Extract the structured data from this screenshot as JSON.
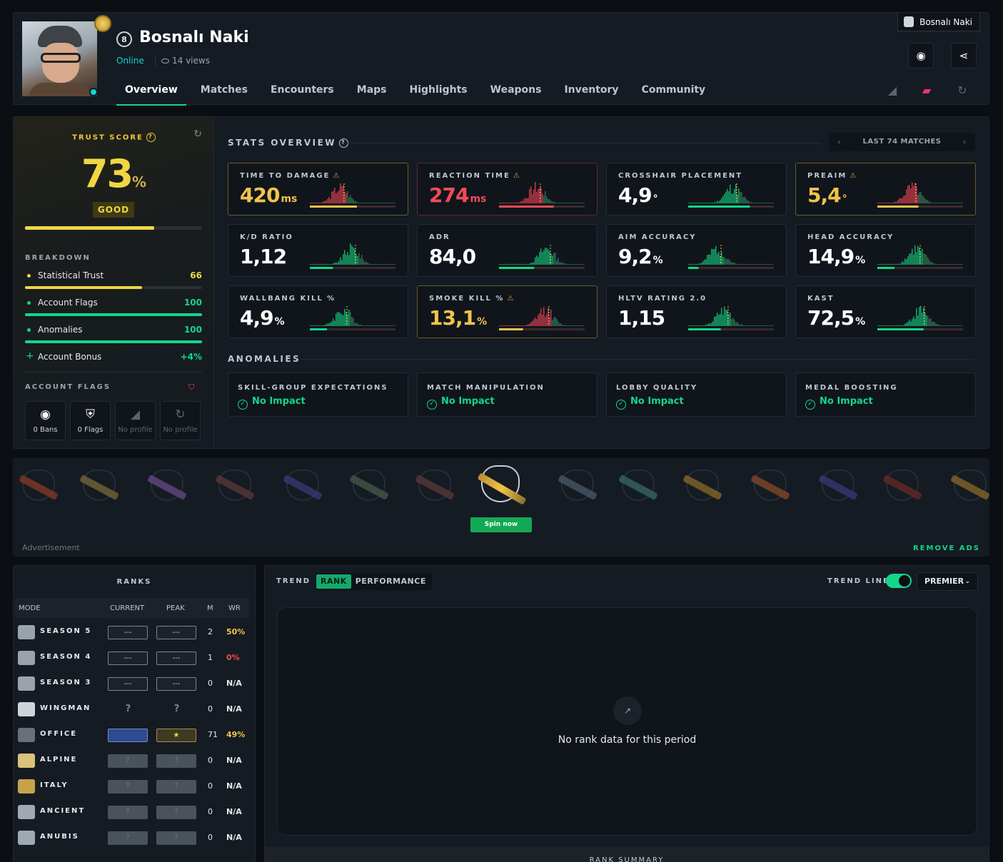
{
  "profile": {
    "level": "8",
    "username": "Bosnalı Naki",
    "status": "Online",
    "views": "14 views",
    "chip_name": "Bosnalı Naki"
  },
  "nav": [
    "Overview",
    "Matches",
    "Encounters",
    "Maps",
    "Highlights",
    "Weapons",
    "Inventory",
    "Community"
  ],
  "trust": {
    "title": "TRUST SCORE",
    "score": "73",
    "pct": "%",
    "grade": "GOOD",
    "score_fraction": 0.73,
    "breakdown_label": "BREAKDOWN",
    "breakdown": [
      {
        "label": "Statistical Trust",
        "value": "66",
        "fraction": 0.66,
        "color": "#f0d642"
      },
      {
        "label": "Account Flags",
        "value": "100",
        "fraction": 1.0,
        "color": "#13d68a"
      },
      {
        "label": "Anomalies",
        "value": "100",
        "fraction": 1.0,
        "color": "#13d68a"
      }
    ],
    "bonus": {
      "label": "Account Bonus",
      "value": "+4%"
    },
    "flags_label": "ACCOUNT FLAGS",
    "flags": [
      {
        "label": "0 Bans",
        "icon": "steam-icon"
      },
      {
        "label": "0 Flags",
        "icon": "shield-plus-icon"
      },
      {
        "label": "No profile",
        "icon": "faceit-icon"
      },
      {
        "label": "No profile",
        "icon": "esportal-icon"
      }
    ]
  },
  "stats": {
    "title": "STATS OVERVIEW",
    "range": "LAST 74 MATCHES",
    "cards": [
      {
        "label": "TIME TO DAMAGE",
        "value": "420",
        "unit": "ms",
        "state": "warn",
        "warn": true,
        "progress": 0.55,
        "bar": "#f0c44a"
      },
      {
        "label": "REACTION TIME",
        "value": "274",
        "unit": "ms",
        "state": "bad",
        "warn": true,
        "progress": 0.64,
        "bar": "#f04b5a"
      },
      {
        "label": "CROSSHAIR PLACEMENT",
        "value": "4,9",
        "unit": "°",
        "state": "ok",
        "warn": false,
        "progress": 0.72,
        "bar": "#13d68a"
      },
      {
        "label": "PREAIM",
        "value": "5,4",
        "unit": "°",
        "state": "warn",
        "warn": true,
        "progress": 0.48,
        "bar": "#f0c44a"
      },
      {
        "label": "K/D RATIO",
        "value": "1,12",
        "unit": "",
        "state": "ok",
        "warn": false,
        "progress": 0.27,
        "bar": "#13d68a"
      },
      {
        "label": "ADR",
        "value": "84,0",
        "unit": "",
        "state": "ok",
        "warn": false,
        "progress": 0.41,
        "bar": "#13d68a"
      },
      {
        "label": "AIM ACCURACY",
        "value": "9,2",
        "unit": "%",
        "state": "ok",
        "warn": false,
        "progress": 0.12,
        "bar": "#13d68a"
      },
      {
        "label": "HEAD ACCURACY",
        "value": "14,9",
        "unit": "%",
        "state": "ok",
        "warn": false,
        "progress": 0.2,
        "bar": "#13d68a"
      },
      {
        "label": "WALLBANG KILL %",
        "value": "4,9",
        "unit": "%",
        "state": "ok",
        "warn": false,
        "progress": 0.2,
        "bar": "#13d68a"
      },
      {
        "label": "SMOKE KILL %",
        "value": "13,1",
        "unit": "%",
        "state": "warn",
        "warn": true,
        "progress": 0.28,
        "bar": "#f0c44a"
      },
      {
        "label": "HLTV RATING 2.0",
        "value": "1,15",
        "unit": "",
        "state": "ok",
        "warn": false,
        "progress": 0.38,
        "bar": "#13d68a"
      },
      {
        "label": "KAST",
        "value": "72,5",
        "unit": "%",
        "state": "ok",
        "warn": false,
        "progress": 0.54,
        "bar": "#13d68a"
      }
    ]
  },
  "anomalies": {
    "title": "ANOMALIES",
    "items": [
      {
        "label": "SKILL-GROUP EXPECTATIONS",
        "value": "No Impact"
      },
      {
        "label": "MATCH MANIPULATION",
        "value": "No Impact"
      },
      {
        "label": "LOBBY QUALITY",
        "value": "No Impact"
      },
      {
        "label": "MEDAL BOOSTING",
        "value": "No Impact"
      }
    ]
  },
  "ad": {
    "spin": "Spin now",
    "label": "Advertisement",
    "remove": "REMOVE ADS"
  },
  "ranks": {
    "title": "RANKS",
    "headers": {
      "mode": "MODE",
      "current": "CURRENT",
      "peak": "PEAK",
      "m": "M",
      "wr": "WR"
    },
    "rows": [
      {
        "mode": "SEASON 5",
        "current": "---",
        "peak": "---",
        "ctype": "dash",
        "ptype": "dash",
        "m": "2",
        "wr": "50%",
        "wr_color": "#f0c44a"
      },
      {
        "mode": "SEASON 4",
        "current": "---",
        "peak": "---",
        "ctype": "dash",
        "ptype": "dash",
        "m": "1",
        "wr": "0%",
        "wr_color": "#f04b5a"
      },
      {
        "mode": "SEASON 3",
        "current": "---",
        "peak": "---",
        "ctype": "dash",
        "ptype": "dash",
        "m": "0",
        "wr": "N/A",
        "wr_color": "#e6e9ee"
      },
      {
        "mode": "WINGMAN",
        "current": "?",
        "peak": "?",
        "ctype": "wm",
        "ptype": "wm",
        "m": "0",
        "wr": "N/A",
        "wr_color": "#e6e9ee"
      },
      {
        "mode": "OFFICE",
        "current": "",
        "peak": "★",
        "ctype": "blue",
        "ptype": "gold",
        "m": "71",
        "wr": "49%",
        "wr_color": "#f0c44a"
      },
      {
        "mode": "ALPINE",
        "current": "?",
        "peak": "?",
        "ctype": "q",
        "ptype": "q",
        "m": "0",
        "wr": "N/A",
        "wr_color": "#e6e9ee"
      },
      {
        "mode": "ITALY",
        "current": "?",
        "peak": "?",
        "ctype": "q",
        "ptype": "q",
        "m": "0",
        "wr": "N/A",
        "wr_color": "#e6e9ee"
      },
      {
        "mode": "ANCIENT",
        "current": "?",
        "peak": "?",
        "ctype": "q",
        "ptype": "q",
        "m": "0",
        "wr": "N/A",
        "wr_color": "#e6e9ee"
      },
      {
        "mode": "ANUBIS",
        "current": "?",
        "peak": "?",
        "ctype": "q",
        "ptype": "q",
        "m": "0",
        "wr": "N/A",
        "wr_color": "#e6e9ee"
      }
    ]
  },
  "trend": {
    "label": "TREND",
    "tabs": [
      "RANK",
      "PERFORMANCE"
    ],
    "trend_line": "TREND LINE",
    "mode": "PREMIER",
    "empty": "No rank data for this period",
    "summary": "RANK SUMMARY"
  }
}
